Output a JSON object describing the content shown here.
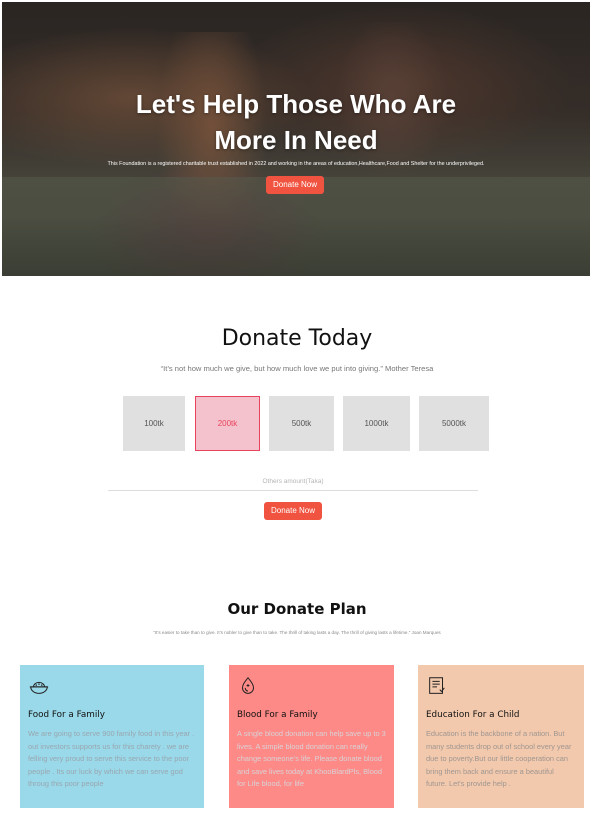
{
  "hero": {
    "title_line1": "Let's Help Those Who Are",
    "title_line2": "More In Need",
    "subtitle": "This Foundation is a registered charitable trust established in 2022 and working in the areas of education,Healthcare,Food and Shelter for the underprivileged.",
    "button_label": "Donate Now",
    "image": "flood-family-photo"
  },
  "donate": {
    "title": "Donate Today",
    "quote": "“It’s not how much we give, but how much love we put into giving.” Mother Teresa",
    "amounts": [
      "100tk",
      "200tk",
      "500tk",
      "1000tk",
      "5000tk"
    ],
    "selected_amount": "200tk",
    "other_amount_placeholder": "Others amount(Taka)",
    "button_label": "Donate Now"
  },
  "plan": {
    "title": "Our Donate Plan",
    "quote": "“It’s easier to take than to give. It’s nobler to give than to take. The thrill of taking lasts a day. The thrill of giving lasts a lifetime.” Joan Marques",
    "cards": [
      {
        "icon": "food-bowl-icon",
        "title": "Food For a Family",
        "text": "We are going to serve 900 family food in this year . out investors supports us for this charety . we are felling very proud to serve this service to the poor people . Its our luck by which we can serve god throug this poor people",
        "color": "#99d9e9"
      },
      {
        "icon": "blood-drop-icon",
        "title": "Blood For a Family",
        "text": "A single blood donation can help save up to 3 lives. A simple blood donation can really change someone’s life. Please donate blood and save lives today at KhooBlardPls, Blood for Life blood, for life",
        "color": "#fd8a86"
      },
      {
        "icon": "education-book-icon",
        "title": "Education For a Child",
        "text": "Education is the backbone of a nation. But many students drop out of school every year due to poverty.But our little cooperation can bring them back and ensure a beautiful future. Let's provide help .",
        "color": "#f3c9ad"
      }
    ]
  },
  "colors": {
    "accent": "#f0533f",
    "selected_amount_bg": "#f4c2cc",
    "selected_amount_text": "#e8435d"
  }
}
